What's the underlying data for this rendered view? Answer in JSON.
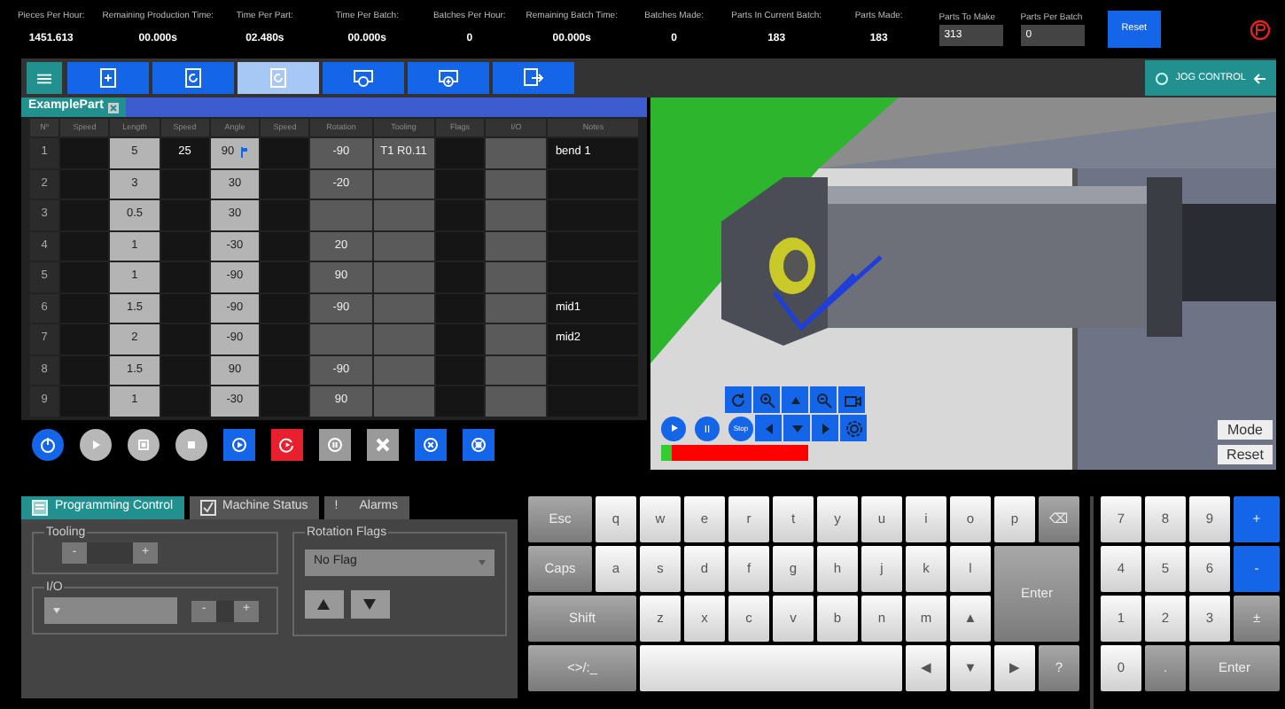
{
  "stats": [
    {
      "label": "Pieces Per Hour:",
      "value": "1451.613"
    },
    {
      "label": "Remaining Production Time:",
      "value": "00.000s"
    },
    {
      "label": "Time Per Part:",
      "value": "02.480s"
    },
    {
      "label": "Time Per Batch:",
      "value": "00.000s"
    },
    {
      "label": "Batches Per Hour:",
      "value": "0"
    },
    {
      "label": "Remaining Batch Time:",
      "value": "00.000s"
    },
    {
      "label": "Batches Made:",
      "value": "0"
    },
    {
      "label": "Parts In Current Batch:",
      "value": "183"
    },
    {
      "label": "Parts Made:",
      "value": "183"
    }
  ],
  "inputs": [
    {
      "label": "Parts To Make",
      "value": "313"
    },
    {
      "label": "Parts Per Batch",
      "value": "0"
    }
  ],
  "reset_button": "Reset",
  "toolbar": [
    {
      "selected": false
    },
    {
      "selected": false
    },
    {
      "selected": true
    },
    {
      "selected": false
    },
    {
      "selected": false
    },
    {
      "selected": false
    }
  ],
  "jog_control": "JOG CONTROL",
  "part_tab": "ExamplePart",
  "columns": [
    {
      "label": "Nº",
      "kind": "index"
    },
    {
      "label": "Speed",
      "kind": "dark"
    },
    {
      "label": "Length",
      "kind": "light"
    },
    {
      "label": "Speed",
      "kind": "dark"
    },
    {
      "label": "Angle",
      "kind": "angle"
    },
    {
      "label": "Speed",
      "kind": "dark"
    },
    {
      "label": "Rotation",
      "kind": "mid"
    },
    {
      "label": "Tooling",
      "kind": "mid"
    },
    {
      "label": "Flags",
      "kind": "dark"
    },
    {
      "label": "I/O",
      "kind": "mid"
    },
    {
      "label": "Notes",
      "kind": "notes"
    }
  ],
  "rows": [
    {
      "cells": [
        "1",
        null,
        "5",
        "25",
        "90",
        null,
        "-90",
        "T1 R0.11",
        null,
        null,
        "bend 1"
      ],
      "flagged": true
    },
    {
      "cells": [
        "2",
        null,
        "3",
        null,
        "30",
        null,
        "-20",
        null,
        null,
        null,
        null
      ],
      "flagged": false
    },
    {
      "cells": [
        "3",
        null,
        "0.5",
        null,
        "30",
        null,
        null,
        null,
        null,
        null,
        null
      ],
      "flagged": false
    },
    {
      "cells": [
        "4",
        null,
        "1",
        null,
        "-30",
        null,
        "20",
        null,
        null,
        null,
        null
      ],
      "flagged": false
    },
    {
      "cells": [
        "5",
        null,
        "1",
        null,
        "-90",
        null,
        "90",
        null,
        null,
        null,
        null
      ],
      "flagged": false
    },
    {
      "cells": [
        "6",
        null,
        "1.5",
        null,
        "-90",
        null,
        "-90",
        null,
        null,
        null,
        "mid1"
      ],
      "flagged": false
    },
    {
      "cells": [
        "7",
        null,
        "2",
        null,
        "-90",
        null,
        null,
        null,
        null,
        null,
        "mid2"
      ],
      "flagged": false
    },
    {
      "cells": [
        "8",
        null,
        "1.5",
        null,
        "90",
        null,
        "-90",
        null,
        null,
        null,
        null
      ],
      "flagged": false
    },
    {
      "cells": [
        "9",
        null,
        "1",
        null,
        "-30",
        null,
        "90",
        null,
        null,
        null,
        null
      ],
      "flagged": false
    }
  ],
  "run_controls": [
    {
      "kind": "round",
      "color": "#1565e8"
    },
    {
      "kind": "round",
      "color": "#b8b8b8"
    },
    {
      "kind": "round",
      "color": "#b8b8b8"
    },
    {
      "kind": "round",
      "color": "#b8b8b8"
    },
    {
      "kind": "square",
      "color": "#1565e8"
    },
    {
      "kind": "square",
      "color": "#e8202e"
    },
    {
      "kind": "square",
      "color": "#9a9a9a"
    },
    {
      "kind": "square",
      "color": "#9a9a9a"
    },
    {
      "kind": "square",
      "color": "#1565e8"
    },
    {
      "kind": "square",
      "color": "#1565e8"
    }
  ],
  "view": {
    "stop_button": "Stop",
    "progress": {
      "level": 0.07
    },
    "mode_button": "Mode",
    "reset_button": "Reset"
  },
  "bottom_tabs": [
    {
      "label": "Programming Control",
      "selected": true
    },
    {
      "label": "Machine Status",
      "selected": false
    },
    {
      "label": "!",
      "label2": "Alarms",
      "selected": false
    }
  ],
  "tooling": {
    "legend": "Tooling",
    "minus": "-",
    "plus": "+"
  },
  "io": {
    "legend": "I/O",
    "minus": "-",
    "plus": "+"
  },
  "rotation_flags": {
    "legend": "Rotation Flags",
    "value": "No Flag"
  },
  "keyboard": [
    {
      "label": "Esc",
      "kind": "dark"
    },
    {
      "label": "q",
      "kind": "light"
    },
    {
      "label": "w",
      "kind": "light"
    },
    {
      "label": "e",
      "kind": "light"
    },
    {
      "label": "r",
      "kind": "light"
    },
    {
      "label": "t",
      "kind": "light"
    },
    {
      "label": "y",
      "kind": "light"
    },
    {
      "label": "u",
      "kind": "light"
    },
    {
      "label": "i",
      "kind": "light"
    },
    {
      "label": "o",
      "kind": "light"
    },
    {
      "label": "p",
      "kind": "light"
    },
    {
      "label": "⌫",
      "kind": "dark"
    },
    {
      "label": "Caps",
      "kind": "dark"
    },
    {
      "label": "a",
      "kind": "light"
    },
    {
      "label": "s",
      "kind": "light"
    },
    {
      "label": "d",
      "kind": "light"
    },
    {
      "label": "f",
      "kind": "light"
    },
    {
      "label": "g",
      "kind": "light"
    },
    {
      "label": "h",
      "kind": "light"
    },
    {
      "label": "j",
      "kind": "light"
    },
    {
      "label": "k",
      "kind": "light"
    },
    {
      "label": "l",
      "kind": "light"
    },
    {
      "label": "Enter",
      "kind": "dark"
    },
    {
      "label": "Shift",
      "kind": "dark"
    },
    {
      "label": "z",
      "kind": "light"
    },
    {
      "label": "x",
      "kind": "light"
    },
    {
      "label": "c",
      "kind": "light"
    },
    {
      "label": "v",
      "kind": "light"
    },
    {
      "label": "b",
      "kind": "light"
    },
    {
      "label": "n",
      "kind": "light"
    },
    {
      "label": "m",
      "kind": "light"
    },
    {
      "label": "▲",
      "kind": "light"
    },
    {
      "label": "<>/:_",
      "kind": "dark"
    },
    {
      "kind": "space"
    },
    {
      "label": "◀",
      "kind": "light"
    },
    {
      "label": "▼",
      "kind": "light"
    },
    {
      "label": "▶",
      "kind": "light"
    },
    {
      "label": "?",
      "kind": "dark"
    }
  ],
  "numpad": [
    {
      "label": "7",
      "kind": "light"
    },
    {
      "label": "8",
      "kind": "light"
    },
    {
      "label": "9",
      "kind": "light"
    },
    {
      "label": "+",
      "kind": "blue"
    },
    {
      "label": "4",
      "kind": "light"
    },
    {
      "label": "5",
      "kind": "light"
    },
    {
      "label": "6",
      "kind": "light"
    },
    {
      "label": "-",
      "kind": "blue"
    },
    {
      "label": "1",
      "kind": "light"
    },
    {
      "label": "2",
      "kind": "light"
    },
    {
      "label": "3",
      "kind": "light"
    },
    {
      "label": "±",
      "kind": "dark"
    },
    {
      "label": "0",
      "kind": "light"
    },
    {
      "label": ".",
      "kind": "dark"
    },
    {
      "label": "Enter",
      "kind": "dark"
    }
  ]
}
